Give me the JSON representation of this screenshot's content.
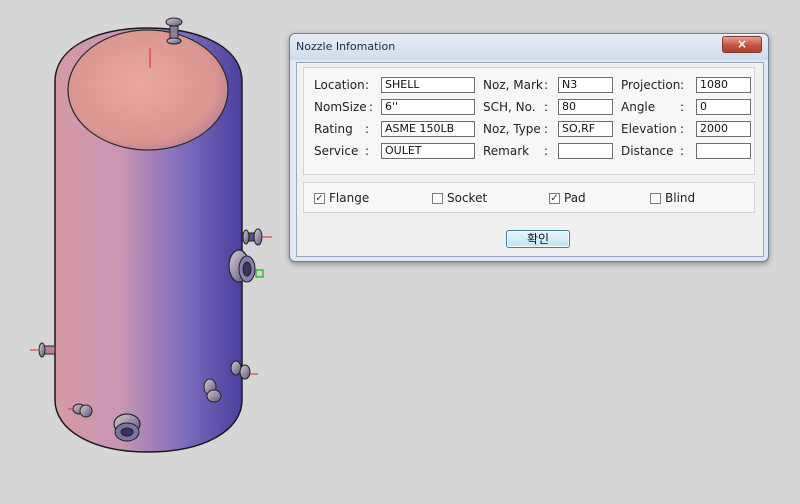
{
  "dialog": {
    "title": "Nozzle Infomation",
    "close_glyph": "×",
    "ok_label": "확인",
    "fields": {
      "location": {
        "label": "Location",
        "colon": ":",
        "value": "SHELL"
      },
      "nozmark": {
        "label": "Noz, Mark",
        "colon": ":",
        "value": "N3"
      },
      "projection": {
        "label": "Projection",
        "colon": ":",
        "value": "1080"
      },
      "nomsize": {
        "label": "NomSize",
        "colon": ":",
        "value": "6''"
      },
      "schno": {
        "label": "SCH, No.",
        "colon": ":",
        "value": "80"
      },
      "angle": {
        "label": "Angle",
        "colon": ":",
        "value": "0"
      },
      "rating": {
        "label": "Rating",
        "colon": ":",
        "value": "ASME 150LB"
      },
      "noztype": {
        "label": "Noz, Type",
        "colon": ":",
        "value": "SO,RF"
      },
      "elevation": {
        "label": "Elevation",
        "colon": ":",
        "value": "2000"
      },
      "service": {
        "label": "Service",
        "colon": ":",
        "value": "OULET"
      },
      "remark": {
        "label": "Remark",
        "colon": ":",
        "value": ""
      },
      "distance": {
        "label": "Distance",
        "colon": ":",
        "value": ""
      }
    },
    "options": {
      "check_glyph": "✓",
      "flange": {
        "label": "Flange",
        "checked": true
      },
      "socket": {
        "label": "Socket",
        "checked": false
      },
      "pad": {
        "label": "Pad",
        "checked": true
      },
      "blind": {
        "label": "Blind",
        "checked": false
      }
    }
  },
  "colors": {
    "background": "#d6d6d6",
    "vessel_light": "#e4a6a4",
    "vessel_dark": "#4a3f9e",
    "dialog_frame": "#dfe8f3",
    "close_button": "#c4543f"
  }
}
